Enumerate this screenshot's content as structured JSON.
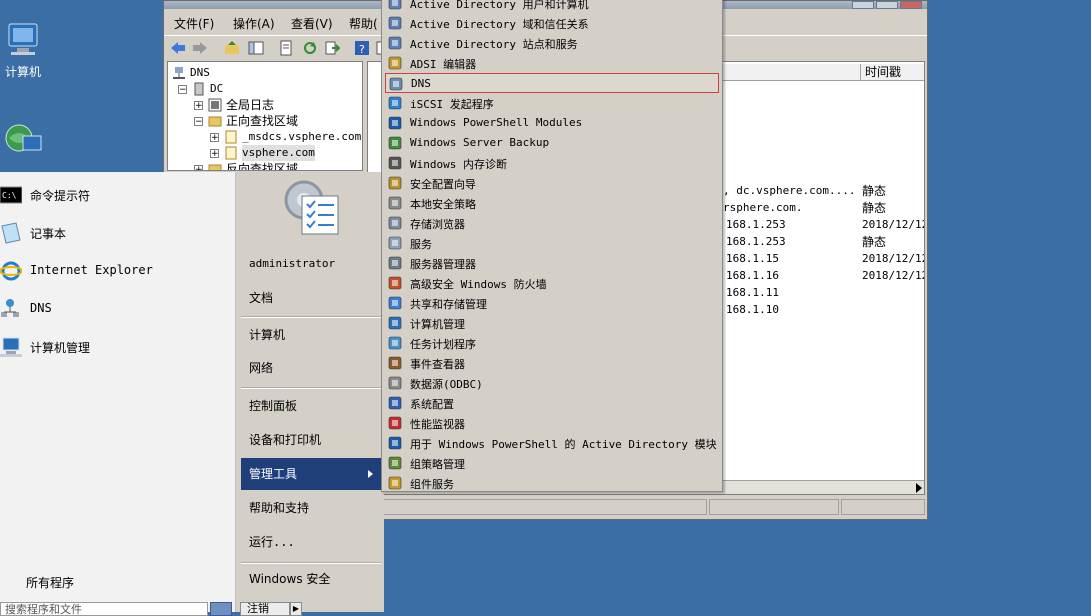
{
  "desktop": {
    "icons": [
      {
        "label": "计算机",
        "icon": "computer-icon"
      },
      {
        "label": "",
        "icon": "network-icon"
      }
    ]
  },
  "dns_window": {
    "menu": [
      "文件(F)",
      "操作(A)",
      "查看(V)",
      "帮助("
    ],
    "tree": [
      {
        "label": "DNS",
        "level": 0,
        "expander": ""
      },
      {
        "label": "DC",
        "level": 1,
        "expander": "−"
      },
      {
        "label": "全局日志",
        "level": 2,
        "expander": "+"
      },
      {
        "label": "正向查找区域",
        "level": 2,
        "expander": "−"
      },
      {
        "label": "_msdcs.vsphere.com",
        "level": 3,
        "expander": "+"
      },
      {
        "label": "vsphere.com",
        "level": 3,
        "expander": "+"
      },
      {
        "label": "反向查找区域",
        "level": 2,
        "expander": "+"
      }
    ],
    "columns": [
      "",
      "时间戳"
    ],
    "rows": [
      {
        "data": ", dc.vsphere.com....",
        "timestamp": "静态"
      },
      {
        "data": "rsphere.com.",
        "timestamp": "静态"
      },
      {
        "data": "168.1.253",
        "timestamp": "2018/12/12"
      },
      {
        "data": "168.1.253",
        "timestamp": "静态"
      },
      {
        "data": "168.1.15",
        "timestamp": "2018/12/12"
      },
      {
        "data": "168.1.16",
        "timestamp": "2018/12/12"
      },
      {
        "data": "168.1.11",
        "timestamp": ""
      },
      {
        "data": "168.1.10",
        "timestamp": ""
      }
    ]
  },
  "start_menu": {
    "pinned": [
      {
        "label": "命令提示符",
        "icon": "cmd-icon"
      },
      {
        "label": "记事本",
        "icon": "notepad-icon"
      },
      {
        "label": "Internet Explorer",
        "icon": "ie-icon"
      },
      {
        "label": "DNS",
        "icon": "dns-icon"
      },
      {
        "label": "计算机管理",
        "icon": "computer-management-icon"
      }
    ],
    "all_programs": "所有程序",
    "search_placeholder": "搜索程序和文件",
    "right_items": [
      "administrator",
      "文档",
      "计算机",
      "网络",
      "控制面板",
      "设备和打印机",
      "管理工具",
      "帮助和支持",
      "运行...",
      "Windows 安全"
    ],
    "shutdown_label": "注销",
    "active_item": "管理工具"
  },
  "admin_tools": {
    "items": [
      {
        "label": "Active Directory 用户和计算机",
        "icon": "ad-users-icon"
      },
      {
        "label": "Active Directory 域和信任关系",
        "icon": "ad-domains-icon"
      },
      {
        "label": "Active Directory 站点和服务",
        "icon": "ad-sites-icon"
      },
      {
        "label": "ADSI 编辑器",
        "icon": "adsi-icon"
      },
      {
        "label": "DNS",
        "icon": "dns-icon"
      },
      {
        "label": "iSCSI 发起程序",
        "icon": "iscsi-icon"
      },
      {
        "label": "Windows PowerShell Modules",
        "icon": "powershell-icon"
      },
      {
        "label": "Windows Server Backup",
        "icon": "backup-icon"
      },
      {
        "label": "Windows 内存诊断",
        "icon": "memory-icon"
      },
      {
        "label": "安全配置向导",
        "icon": "security-wizard-icon"
      },
      {
        "label": "本地安全策略",
        "icon": "local-policy-icon"
      },
      {
        "label": "存储浏览器",
        "icon": "storage-icon"
      },
      {
        "label": "服务",
        "icon": "services-icon"
      },
      {
        "label": "服务器管理器",
        "icon": "server-manager-icon"
      },
      {
        "label": "高级安全 Windows 防火墙",
        "icon": "firewall-icon"
      },
      {
        "label": "共享和存储管理",
        "icon": "share-icon"
      },
      {
        "label": "计算机管理",
        "icon": "computer-management-icon"
      },
      {
        "label": "任务计划程序",
        "icon": "clock-icon"
      },
      {
        "label": "事件查看器",
        "icon": "event-viewer-icon"
      },
      {
        "label": "数据源(ODBC)",
        "icon": "odbc-icon"
      },
      {
        "label": "系统配置",
        "icon": "msconfig-icon"
      },
      {
        "label": "性能监视器",
        "icon": "perfmon-icon"
      },
      {
        "label": "用于 Windows PowerShell 的 Active Directory 模块",
        "icon": "ad-powershell-icon"
      },
      {
        "label": "组策略管理",
        "icon": "gpo-icon"
      },
      {
        "label": "组件服务",
        "icon": "component-services-icon"
      }
    ],
    "hovered_item": "DNS"
  }
}
